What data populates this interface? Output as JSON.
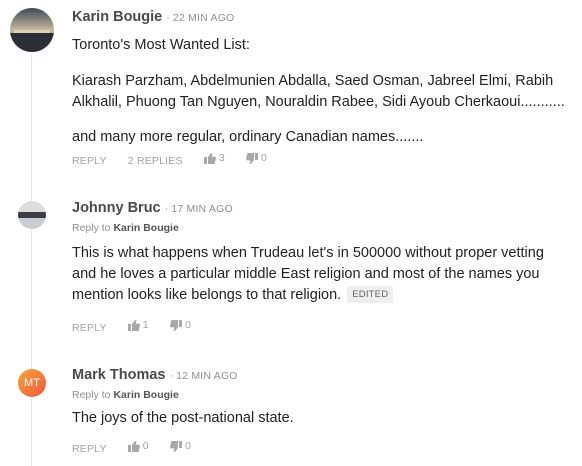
{
  "comments": [
    {
      "author": "Karin Bougie",
      "time": "22 MIN AGO",
      "paragraphs": [
        "Toronto's Most Wanted List:",
        "Kiarash Parzham, Abdelmunien Abdalla, Saed Osman, Jabreel Elmi, Rabih Alkhalil, Phuong Tan Nguyen, Nouraldin Rabee, Sidi Ayoub Cherkaoui...........",
        "and many more regular, ordinary Canadian names......."
      ],
      "actions": {
        "reply": "REPLY",
        "replies": "2 REPLIES",
        "upvotes": "3",
        "downvotes": "0"
      }
    },
    {
      "author": "Johnny Bruc",
      "time": "17 MIN AGO",
      "reply_to_prefix": "Reply to",
      "reply_to": "Karin Bougie",
      "text": "This is what happens when Trudeau let's in 500000 without proper vetting and he loves a particular middle East religion and most of the names you mention looks like belongs to that religion.",
      "badge": "EDITED",
      "actions": {
        "reply": "REPLY",
        "upvotes": "1",
        "downvotes": "0"
      }
    },
    {
      "author": "Mark Thomas",
      "initials": "MT",
      "time": "12 MIN AGO",
      "reply_to_prefix": "Reply to",
      "reply_to": "Karin Bougie",
      "text": "The joys of the post-national state.",
      "actions": {
        "reply": "REPLY",
        "upvotes": "0",
        "downvotes": "0"
      }
    }
  ],
  "separator": "·",
  "colors": {
    "accent": "#f0583a",
    "muted": "#8f8f8f"
  }
}
